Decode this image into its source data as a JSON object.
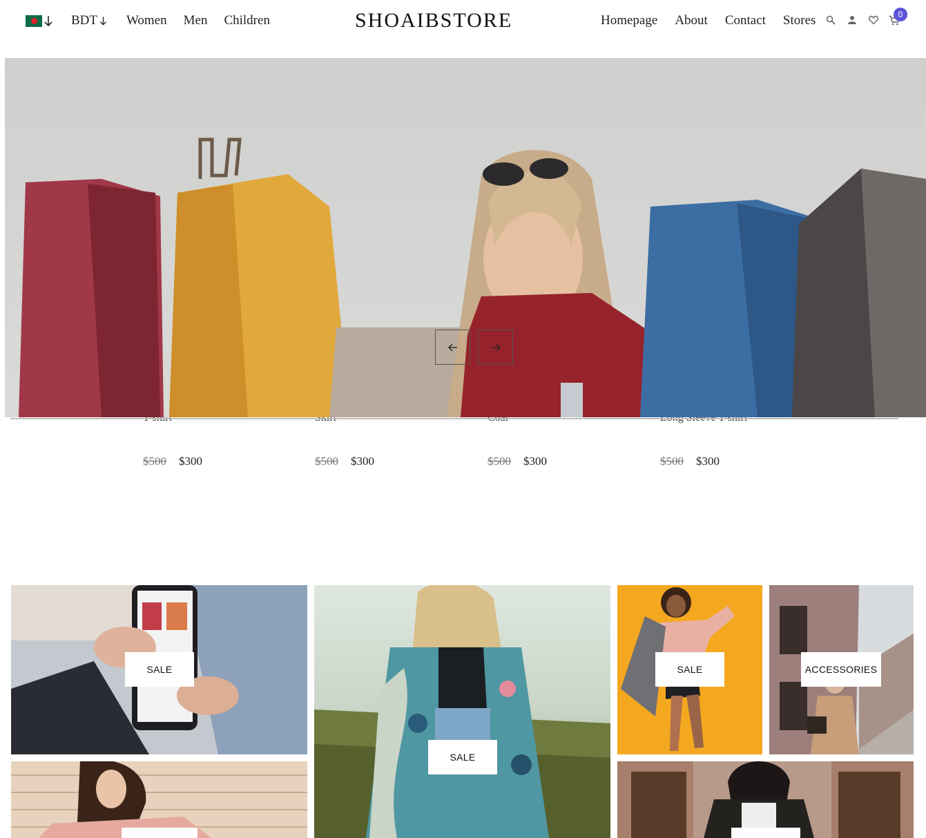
{
  "header": {
    "currency": "BDT",
    "nav_left": [
      "Women",
      "Men",
      "Children"
    ],
    "logo": "SHOAIBSTORE",
    "nav_right": [
      "Homepage",
      "About",
      "Contact",
      "Stores"
    ],
    "cart_count": "0",
    "flag_icon": "bangladesh-flag-icon",
    "accent_color": "#5c55d9"
  },
  "hero": {
    "prev_icon": "arrow-left-icon",
    "next_icon": "arrow-right-icon"
  },
  "products": [
    {
      "name": "T-shirt",
      "old_price": "$500",
      "price": "$300"
    },
    {
      "name": "Skirt",
      "old_price": "$500",
      "price": "$300"
    },
    {
      "name": "Coat",
      "old_price": "$500",
      "price": "$300"
    },
    {
      "name": "Long Sleeve T-shirt",
      "old_price": "$500",
      "price": "$300"
    }
  ],
  "categories": {
    "phone_tile": "SALE",
    "kimono_tile": "SALE",
    "yellow_tile": "SALE",
    "street_tile": "ACCESSORIES"
  }
}
